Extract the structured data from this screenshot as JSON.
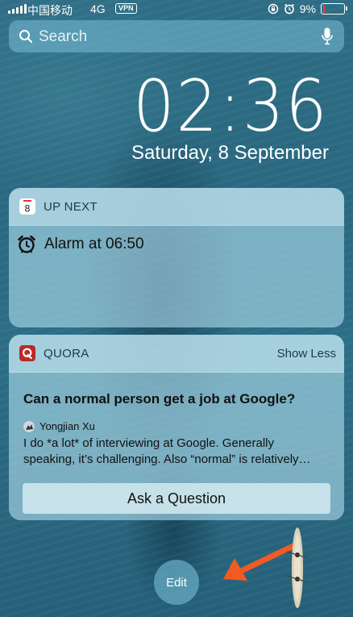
{
  "status_bar": {
    "carrier": "中国移动",
    "network": "4G",
    "vpn": "VPN",
    "battery_percent": "9%",
    "battery_level": 0.09,
    "battery_color": "#ff3b30",
    "icons": [
      "signal-icon",
      "orientation-lock-icon",
      "alarm-icon",
      "battery-icon"
    ]
  },
  "search": {
    "placeholder": "Search",
    "value": ""
  },
  "clock": {
    "time": "02:36",
    "date": "Saturday, 8 September"
  },
  "up_next": {
    "title": "UP NEXT",
    "calendar_icon_day": "8",
    "alarm_text": "Alarm at 06:50"
  },
  "quora": {
    "title": "QUORA",
    "show_less": "Show Less",
    "question": "Can a normal person get a job at Google?",
    "author": "Yongjian Xu",
    "answer_line1": "I do *a lot* of interviewing at Google. Generally",
    "answer_line2": "speaking, it’s challenging. Also “normal” is relatively…",
    "ask_button": "Ask a Question",
    "brand_color": "#b92b27"
  },
  "edit": {
    "label": "Edit"
  },
  "annotation": {
    "arrow_color": "#f25a22"
  }
}
